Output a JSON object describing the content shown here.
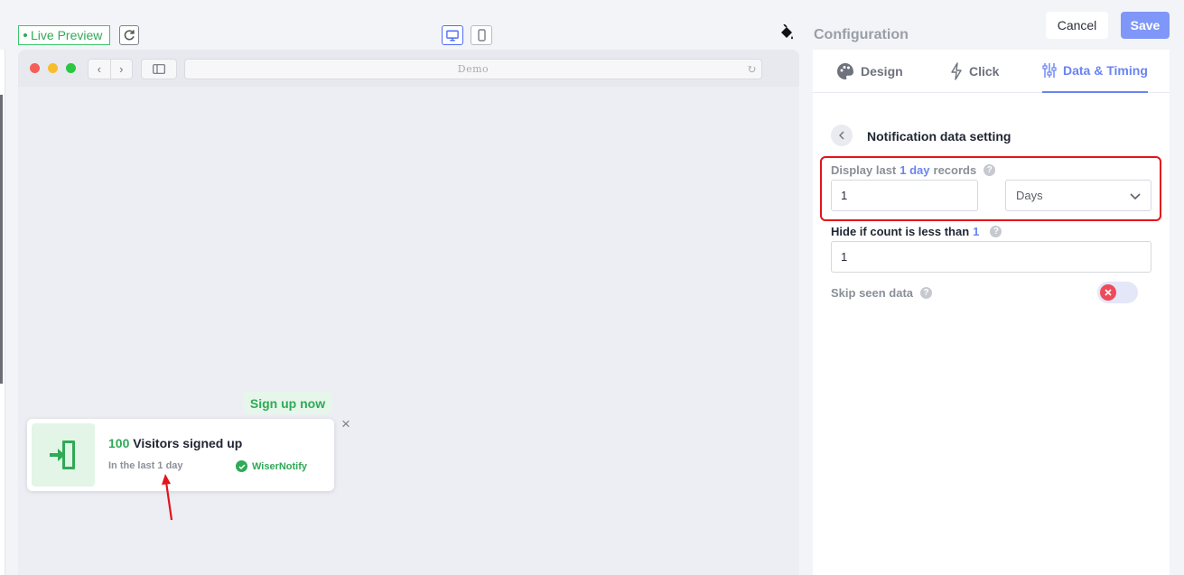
{
  "preview": {
    "live_label": "Live Preview",
    "url_text": "Demo"
  },
  "notification": {
    "cta_label": "Sign up now",
    "count": "100",
    "title": "Visitors signed up",
    "subtitle": "In the last 1 day",
    "brand": "WiserNotify",
    "close_icon": "×"
  },
  "header": {
    "title": "Configuration",
    "cancel_label": "Cancel",
    "save_label": "Save"
  },
  "tabs": [
    {
      "label": "Design",
      "icon": "palette-icon"
    },
    {
      "label": "Click",
      "icon": "lightning-icon"
    },
    {
      "label": "Data & Timing",
      "icon": "sliders-icon",
      "active": true
    }
  ],
  "section": {
    "title": "Notification data setting"
  },
  "fields": {
    "display_last": {
      "label_prefix": "Display last",
      "label_accent": "1 day",
      "label_suffix": "records",
      "value": "1",
      "unit": "Days"
    },
    "hide_if": {
      "label": "Hide if count is less than",
      "label_accent": "1",
      "value": "1"
    },
    "skip_seen": {
      "label": "Skip seen data",
      "enabled": false
    }
  },
  "colors": {
    "accent": "#6a84f2",
    "success": "#2faa56",
    "highlight": "#e3141b"
  }
}
